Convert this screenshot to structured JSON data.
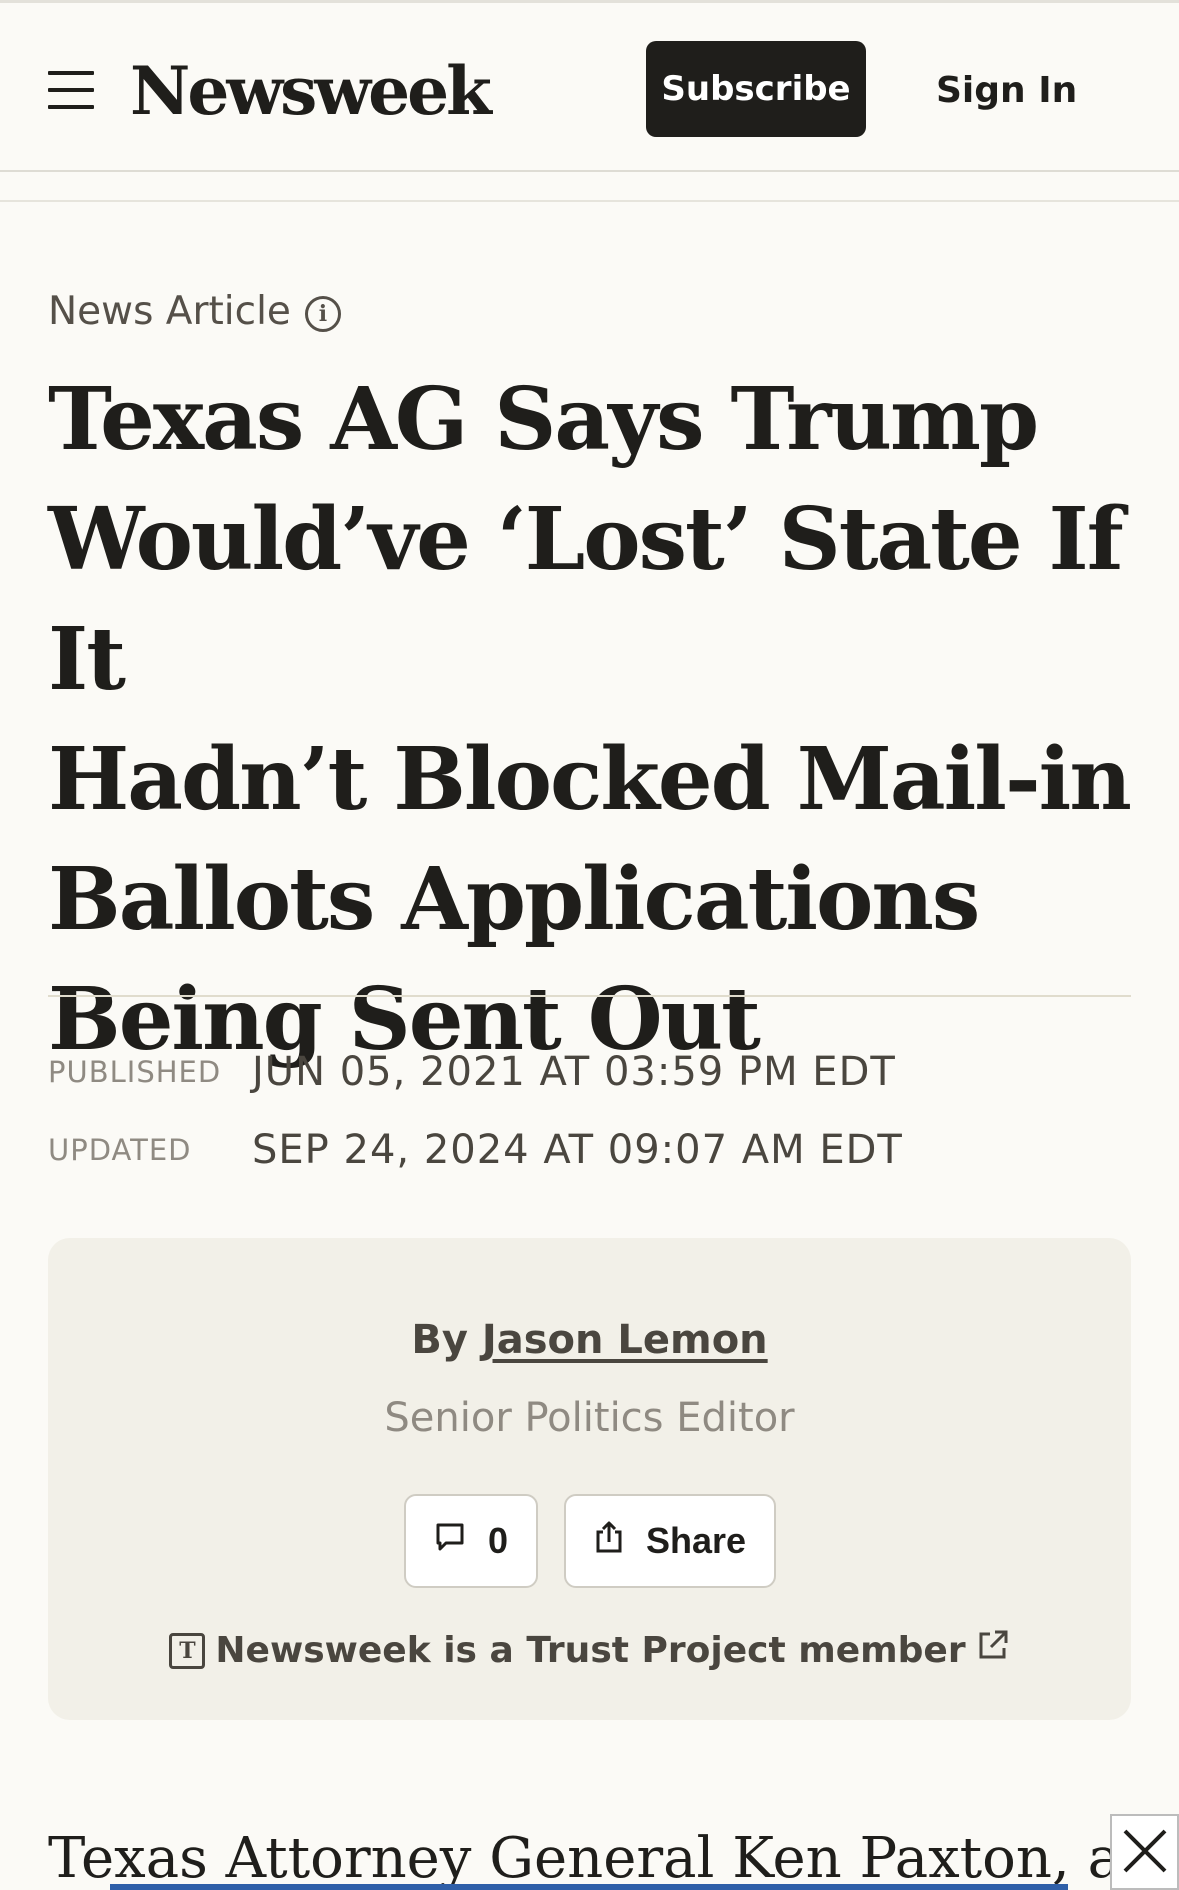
{
  "header": {
    "logo": "Newsweek",
    "subscribe_label": "Subscribe",
    "signin_label": "Sign In"
  },
  "article": {
    "type_label": "News Article",
    "headline_lines": [
      "Texas AG Says Trump",
      "Would’ve ‘Lost’ State If It",
      "Hadn’t Blocked Mail-in",
      "Ballots Applications",
      "Being Sent Out"
    ],
    "published_label": "PUBLISHED",
    "published_value": "JUN 05, 2021 AT 03:59 PM EDT",
    "updated_label": "UPDATED",
    "updated_value": "SEP 24, 2024 AT 09:07 AM EDT"
  },
  "byline": {
    "prefix": "By",
    "author": "Jason Lemon",
    "title": "Senior Politics Editor",
    "comment_count": "0",
    "share_label": "Share",
    "trust_text": "Newsweek is a Trust Project member"
  },
  "body": {
    "lead_before": "Texas Attorney General ",
    "lead_link": "Ken Paxton",
    "lead_after": ", a"
  },
  "icons": {
    "menu": "menu-icon",
    "info": "info-icon",
    "comment": "comment-icon",
    "share": "share-icon",
    "trust": "trust-project-icon",
    "external": "external-link-icon",
    "close": "close-icon"
  }
}
